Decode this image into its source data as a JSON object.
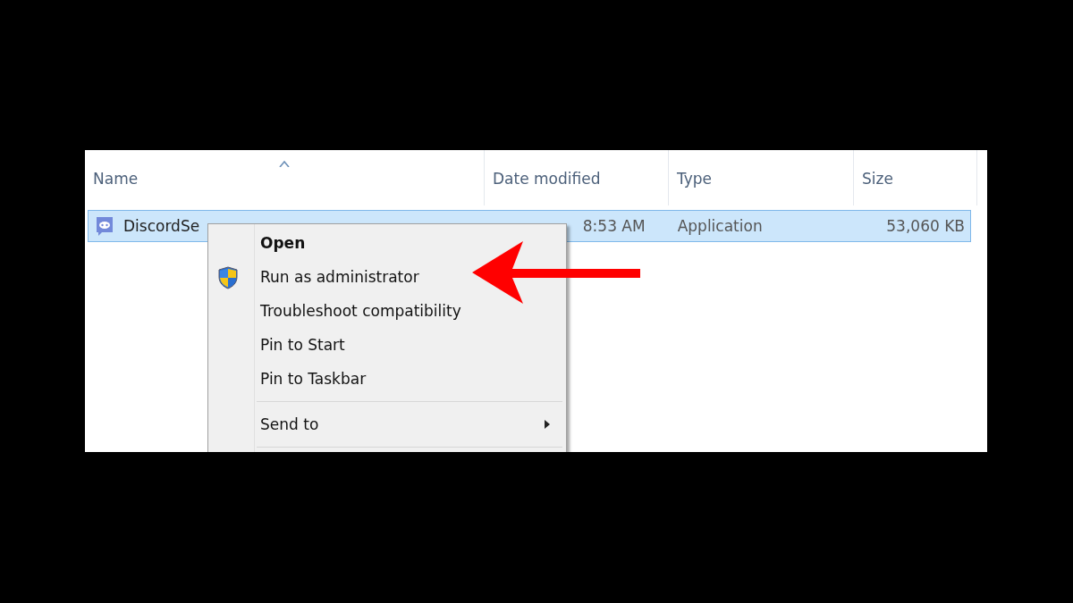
{
  "columns": [
    {
      "label": "Name",
      "sorted": true
    },
    {
      "label": "Date modified",
      "sorted": false
    },
    {
      "label": "Type",
      "sorted": false
    },
    {
      "label": "Size",
      "sorted": false
    }
  ],
  "rows": [
    {
      "name": "DiscordSe",
      "date": "8:53 AM",
      "type": "Application",
      "size": "53,060 KB",
      "selected": true
    }
  ],
  "context_menu": [
    {
      "kind": "item",
      "label": "Open",
      "default": true,
      "shield": false,
      "submenu": false
    },
    {
      "kind": "item",
      "label": "Run as administrator",
      "default": false,
      "shield": true,
      "submenu": false
    },
    {
      "kind": "item",
      "label": "Troubleshoot compatibility",
      "default": false,
      "shield": false,
      "submenu": false
    },
    {
      "kind": "item",
      "label": "Pin to Start",
      "default": false,
      "shield": false,
      "submenu": false
    },
    {
      "kind": "item",
      "label": "Pin to Taskbar",
      "default": false,
      "shield": false,
      "submenu": false
    },
    {
      "kind": "separator"
    },
    {
      "kind": "item",
      "label": "Send to",
      "default": false,
      "shield": false,
      "submenu": true
    },
    {
      "kind": "separator"
    }
  ]
}
